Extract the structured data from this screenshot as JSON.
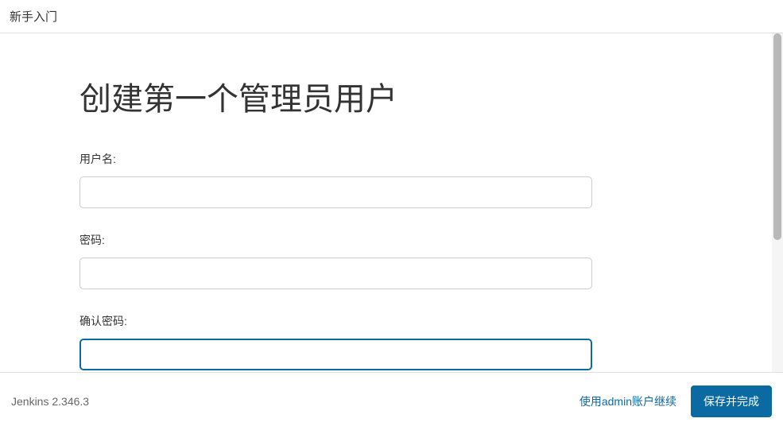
{
  "header": {
    "title": "新手入门"
  },
  "main": {
    "title": "创建第一个管理员用户",
    "form": {
      "username": {
        "label": "用户名:",
        "value": ""
      },
      "password": {
        "label": "密码:",
        "value": ""
      },
      "confirm_password": {
        "label": "确认密码:",
        "value": ""
      }
    }
  },
  "footer": {
    "version": "Jenkins 2.346.3",
    "skip_label": "使用admin账户继续",
    "save_label": "保存并完成"
  }
}
